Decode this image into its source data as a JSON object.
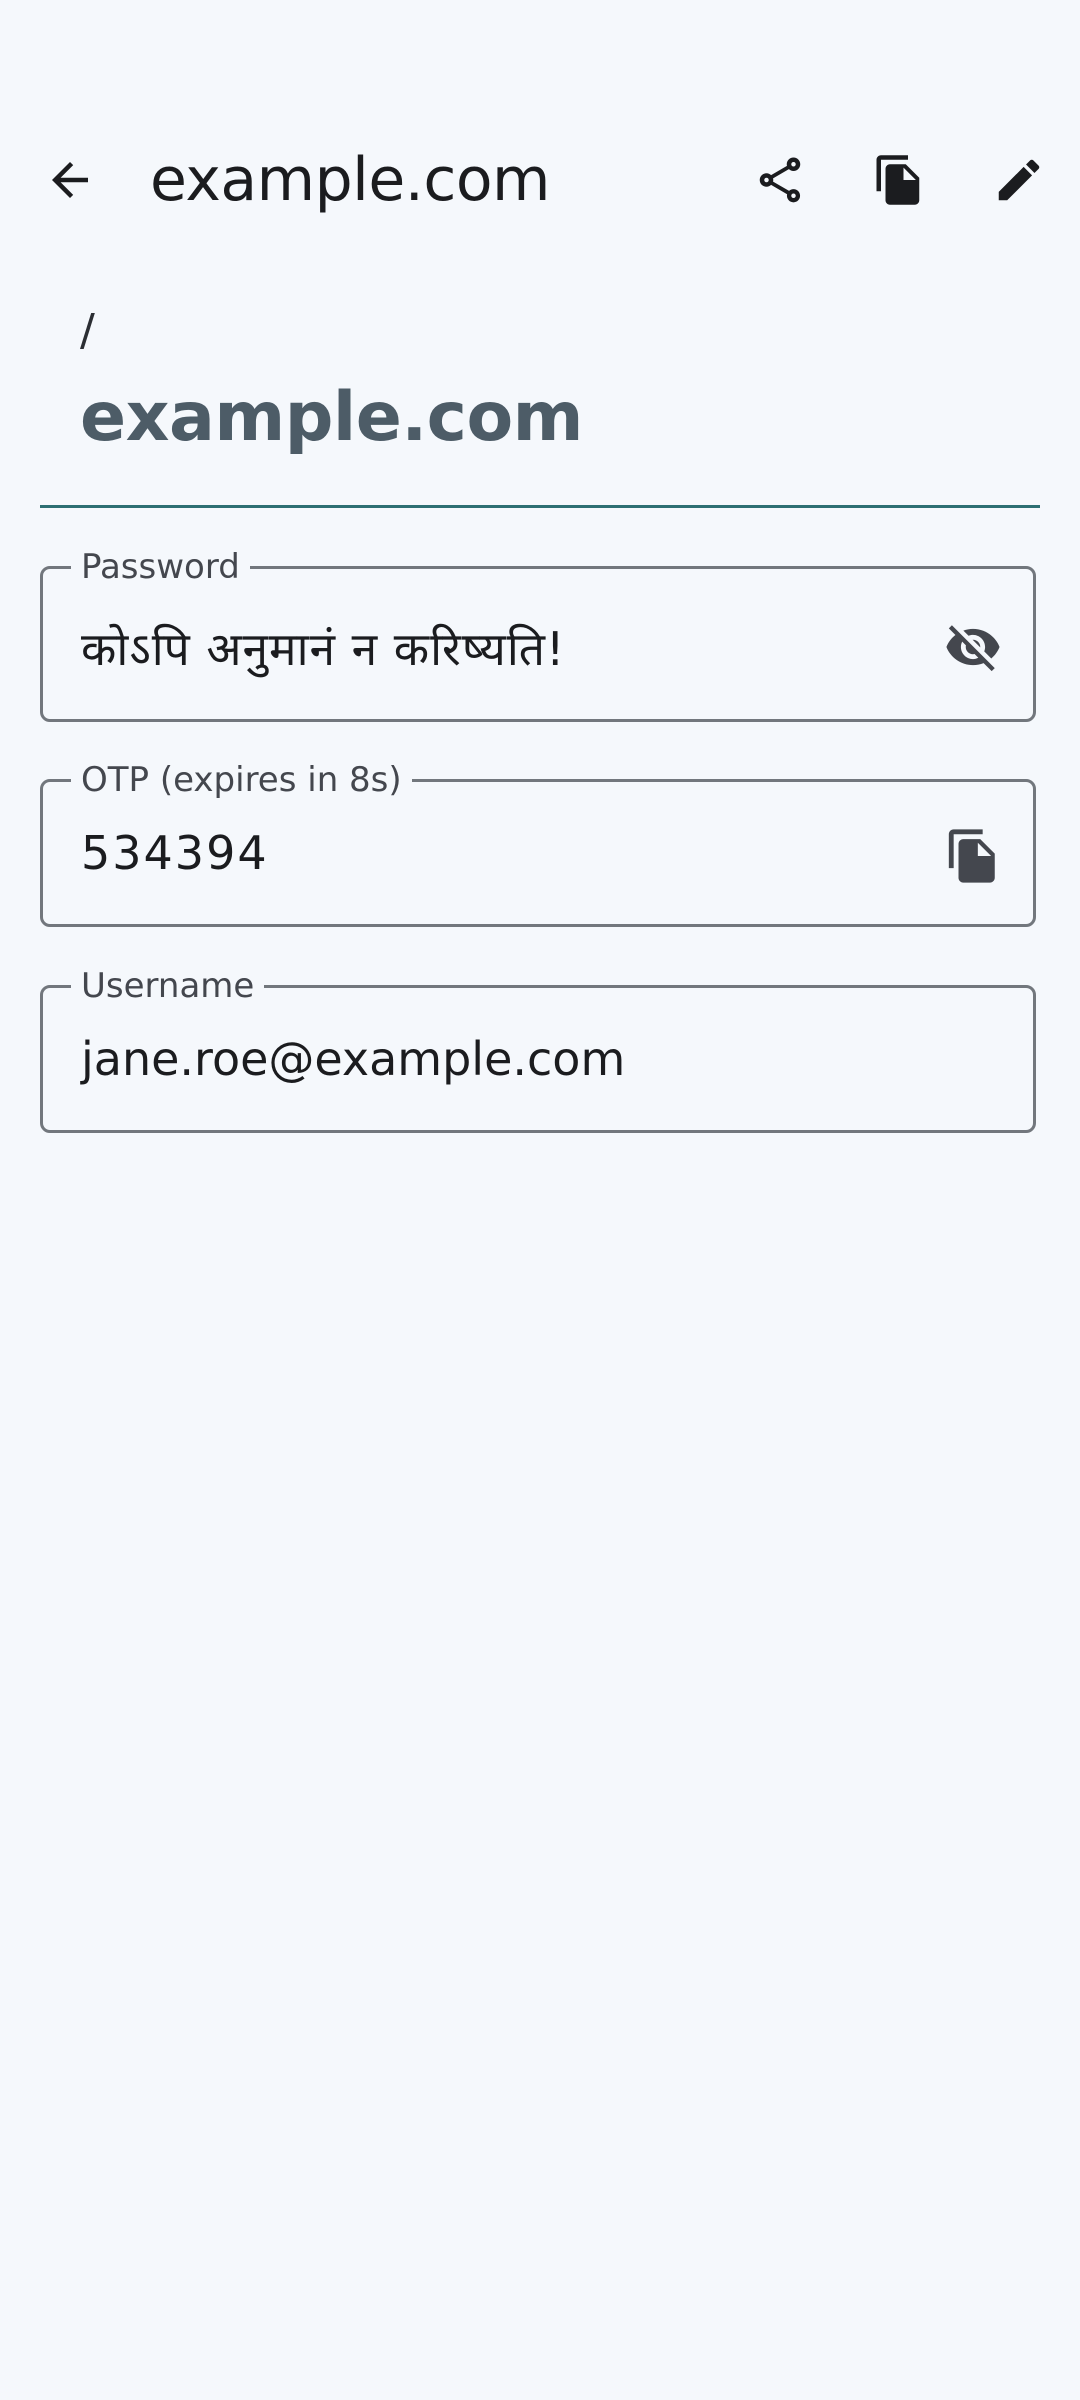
{
  "topbar": {
    "title": "example.com",
    "back_icon": "arrow-back-icon",
    "share_icon": "share-icon",
    "copy_icon": "copy-icon",
    "edit_icon": "edit-icon"
  },
  "header": {
    "path": "/",
    "title": "example.com",
    "title_color": "#4d5c67",
    "divider_color": "#2d6f73"
  },
  "fields": {
    "password": {
      "label": "Password",
      "value": "कोऽपि अनुमानं न करिष्यति!",
      "action_icon": "visibility-off-icon"
    },
    "otp": {
      "label": "OTP (expires in 8s)",
      "value": "534394",
      "action_icon": "copy-icon"
    },
    "username": {
      "label": "Username",
      "value": "jane.roe@example.com"
    }
  }
}
